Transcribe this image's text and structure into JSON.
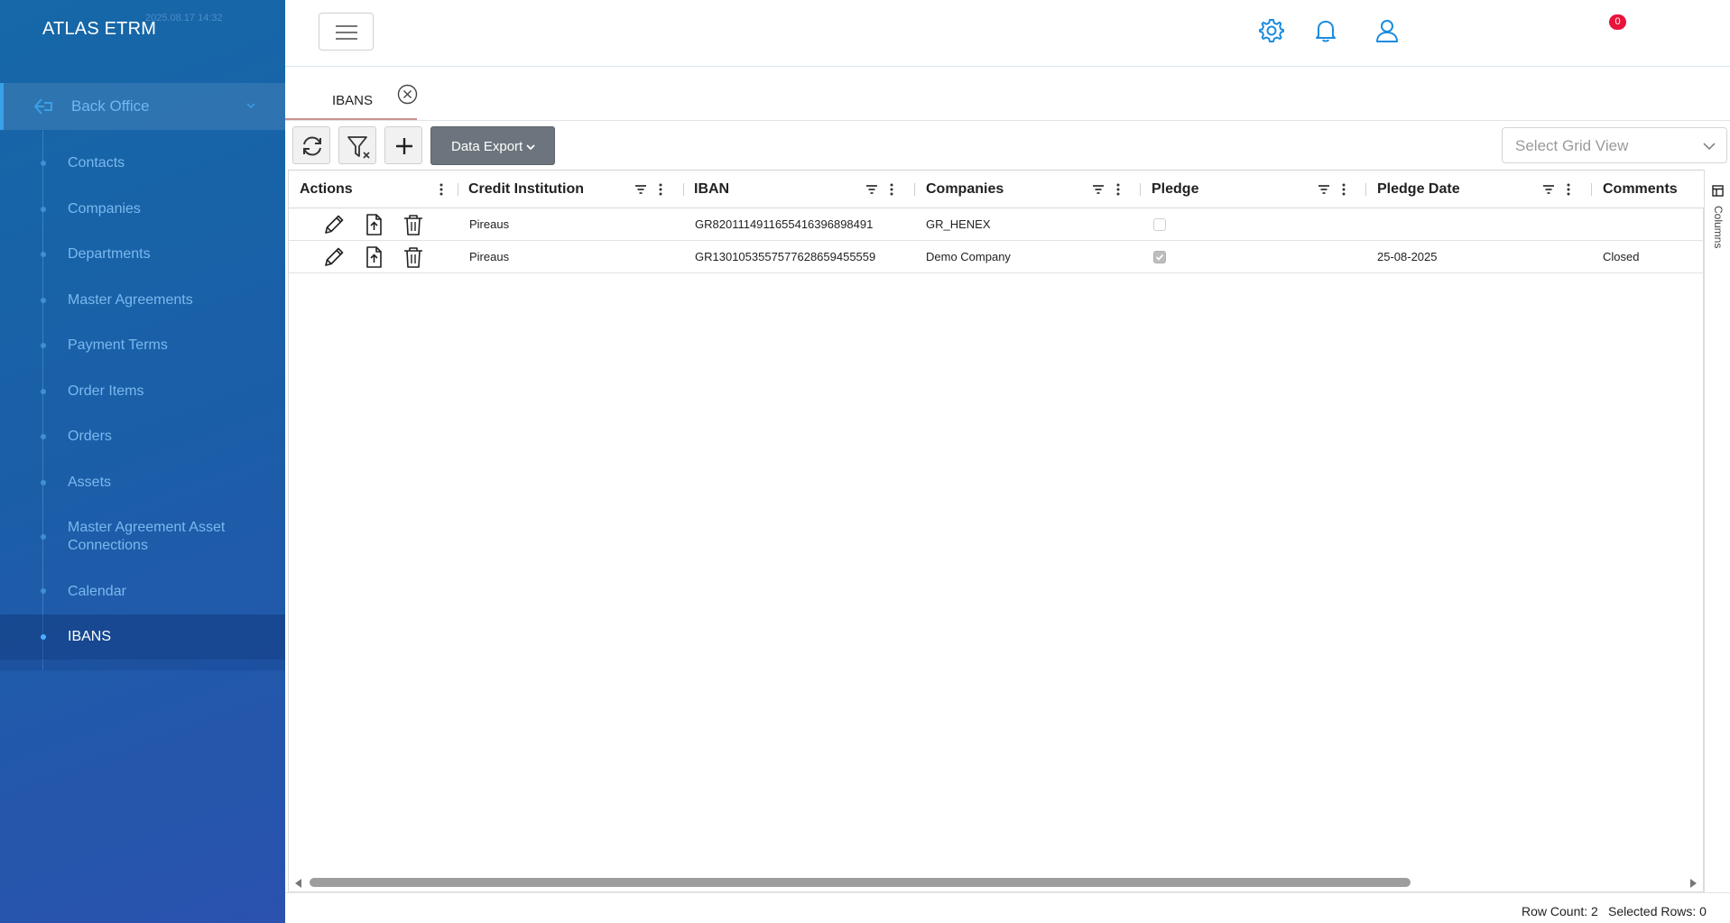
{
  "app": {
    "title": "ATLAS ETRM",
    "build_date": "2025.08.17 14:32",
    "accent_color": "#1a8ce0",
    "badge_color": "#e8143c"
  },
  "sidebar": {
    "section": {
      "label": "Back Office",
      "icon": "back-arrow-icon",
      "expand_icon": "chevron-down-icon"
    },
    "items": [
      {
        "label": "Contacts"
      },
      {
        "label": "Companies"
      },
      {
        "label": "Departments"
      },
      {
        "label": "Master Agreements"
      },
      {
        "label": "Payment Terms"
      },
      {
        "label": "Order Items"
      },
      {
        "label": "Orders"
      },
      {
        "label": "Assets"
      },
      {
        "label": "Master Agreement Asset Connections"
      },
      {
        "label": "Calendar"
      },
      {
        "label": "IBANS",
        "active": true
      }
    ]
  },
  "topbar": {
    "menu_icon": "hamburger-icon",
    "settings_icon": "gear-icon",
    "notifications_icon": "bell-icon",
    "notifications_count": "0",
    "user_icon": "user-icon"
  },
  "tabs": [
    {
      "label": "IBANS",
      "close_icon": "close-circle-icon"
    }
  ],
  "toolbar": {
    "refresh_icon": "refresh-icon",
    "clear_filter_icon": "filter-clear-icon",
    "add_icon": "plus-icon",
    "export_label": "Data Export",
    "grid_view_placeholder": "Select Grid View"
  },
  "grid": {
    "columns": [
      "Actions",
      "Credit Institution",
      "IBAN",
      "Companies",
      "Pledge",
      "Pledge Date",
      "Comments"
    ],
    "rows": [
      {
        "credit_institution": "Pireaus",
        "iban": "GR8201114911655416396898491",
        "companies": "GR_HENEX",
        "pledge": false,
        "pledge_date": "",
        "comments": ""
      },
      {
        "credit_institution": "Pireaus",
        "iban": "GR1301053557577628659455559",
        "companies": "Demo Company",
        "pledge": true,
        "pledge_date": "25-08-2025",
        "comments": "Closed"
      }
    ],
    "row_action_icons": [
      "pencil-icon",
      "file-upload-icon",
      "trash-icon"
    ],
    "side_panel_label": "Columns"
  },
  "status": {
    "row_count_label": "Row Count: 2",
    "selected_rows_label": "Selected Rows: 0"
  }
}
